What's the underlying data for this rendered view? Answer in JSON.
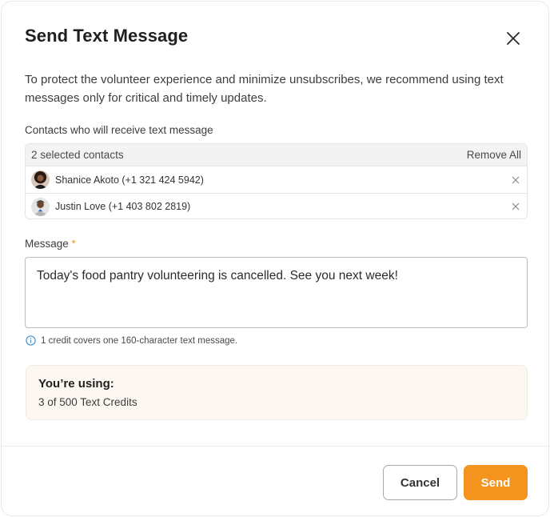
{
  "dialog": {
    "title": "Send Text Message",
    "close_icon": "close-icon",
    "intro": "To protect the volunteer experience and minimize unsubscribes, we recommend using text messages only for critical and timely updates."
  },
  "contacts": {
    "label": "Contacts who will receive text message",
    "summary": "2 selected contacts",
    "remove_all_label": "Remove All",
    "items": [
      {
        "name": "Shanice Akoto (+1 321 424 5942)",
        "avatar": "avatar-photo",
        "remove_icon": "close-icon"
      },
      {
        "name": "Justin Love (+1 403 802 2819)",
        "avatar": "avatar-photo",
        "remove_icon": "close-icon"
      }
    ]
  },
  "message": {
    "label": "Message",
    "required_mark": "*",
    "value": "Today's food pantry volunteering is cancelled. See you next week!",
    "hint": "1 credit covers one 160-character text message.",
    "hint_icon": "info-icon"
  },
  "credits": {
    "title": "You’re using:",
    "value": "3 of 500 Text Credits"
  },
  "footer": {
    "cancel_label": "Cancel",
    "send_label": "Send"
  },
  "colors": {
    "accent": "#f5931f",
    "info": "#3b8fd4",
    "credits_bg": "#fcf8f1"
  }
}
